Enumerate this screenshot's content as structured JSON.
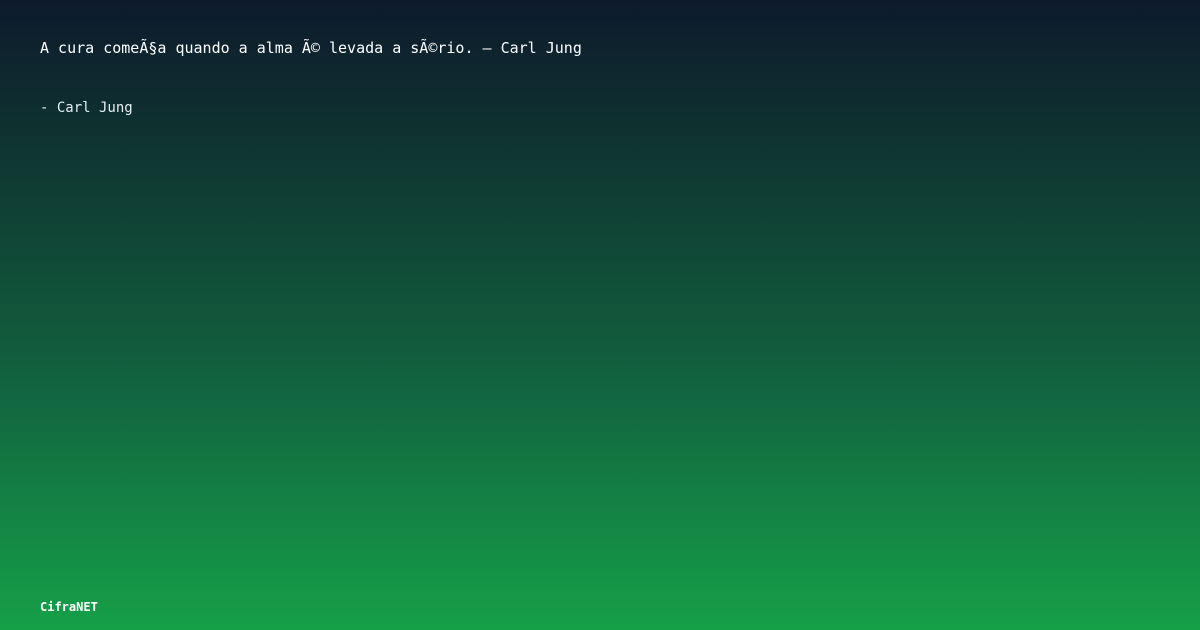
{
  "quote": {
    "text": "A cura comeÃ§a quando a alma Ã© levada a sÃ©rio. – Carl Jung",
    "author": "- Carl Jung"
  },
  "brand": {
    "name": "CifraNET"
  },
  "colors": {
    "gradient_top": "#0d1a2c",
    "gradient_bottom": "#15a048",
    "text": "#ffffff"
  }
}
